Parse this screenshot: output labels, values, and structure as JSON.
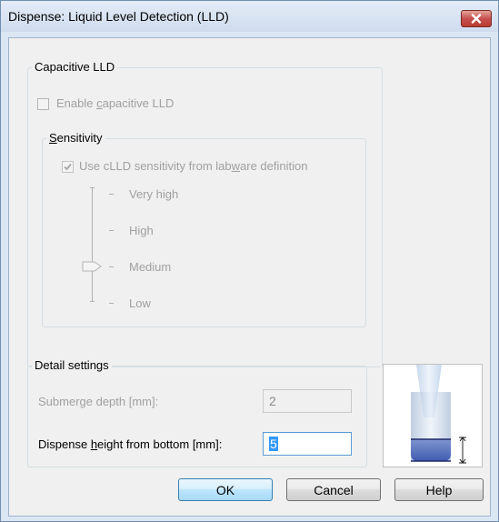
{
  "window": {
    "title": "Dispense: Liquid Level Detection (LLD)",
    "close_icon": "close-icon"
  },
  "capacitive_lld": {
    "legend": "Capacitive LLD",
    "enable_checkbox": {
      "label_pre": "Enable ",
      "label_accel": "c",
      "label_post": "apacitive LLD",
      "checked": false,
      "enabled": false
    },
    "sensitivity": {
      "legend_accel": "S",
      "legend_post": "ensitivity",
      "use_labware": {
        "label_pre": "Use cLLD sensitivity from lab",
        "label_accel": "w",
        "label_post": "are definition",
        "checked": true,
        "enabled": false
      },
      "levels": [
        "Very high",
        "High",
        "Medium",
        "Low"
      ],
      "selected_level": "Medium"
    }
  },
  "detail_settings": {
    "legend": "Detail settings",
    "submerge_depth": {
      "label": "Submerge depth [mm]:",
      "value": "2",
      "enabled": false
    },
    "dispense_height": {
      "label_pre": "Dispense ",
      "label_accel": "h",
      "label_post": "eight from bottom [mm]:",
      "value": "5",
      "enabled": true
    }
  },
  "buttons": {
    "ok": "OK",
    "cancel": "Cancel",
    "help": "Help"
  },
  "colors": {
    "title_bar": "#cfdcee",
    "close": "#c75050",
    "selection": "#3399ff",
    "liquid": "#3f5bb0"
  }
}
